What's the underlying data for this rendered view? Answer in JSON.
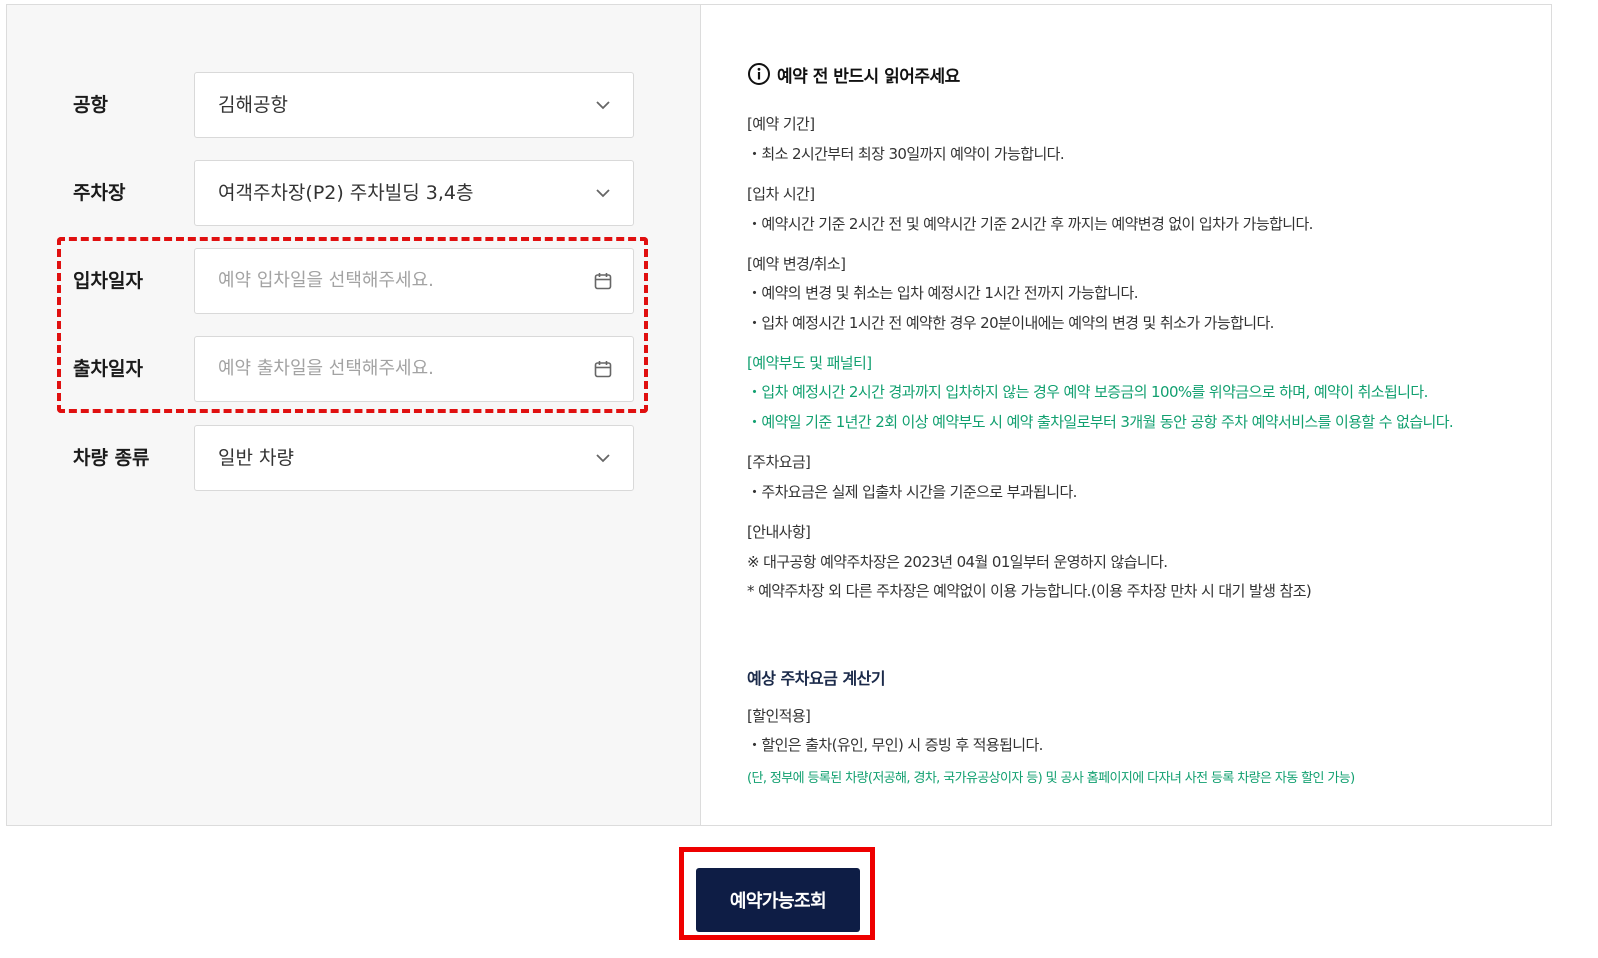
{
  "form": {
    "airport": {
      "label": "공항",
      "value": "김해공항"
    },
    "parking_lot": {
      "label": "주차장",
      "value": "여객주차장(P2) 주차빌딩 3,4층"
    },
    "entry_date": {
      "label": "입차일자",
      "placeholder": "예약 입차일을 선택해주세요."
    },
    "exit_date": {
      "label": "출차일자",
      "placeholder": "예약 출차일을 선택해주세요."
    },
    "vehicle_type": {
      "label": "차량 종류",
      "value": "일반 차량"
    }
  },
  "notice": {
    "title": "예약 전 반드시 읽어주세요",
    "reservation_period": {
      "heading": "[예약 기간]",
      "lines": [
        "・최소 2시간부터 최장 30일까지 예약이 가능합니다."
      ]
    },
    "entry_time": {
      "heading": "[입차 시간]",
      "lines": [
        "・예약시간 기준 2시간 전 및 예약시간 기준 2시간 후 까지는 예약변경 없이 입차가 가능합니다."
      ]
    },
    "change_cancel": {
      "heading": "[예약 변경/취소]",
      "lines": [
        "・예약의 변경 및 취소는 입차 예정시간 1시간 전까지 가능합니다.",
        "・입차 예정시간 1시간 전 예약한 경우 20분이내에는 예약의 변경 및 취소가 가능합니다."
      ]
    },
    "noshow_penalty": {
      "heading": "[예약부도 및 패널티]",
      "lines": [
        "・입차 예정시간 2시간 경과까지 입차하지 않는 경우 예약 보증금의 100%를 위약금으로 하며, 예약이 취소됩니다.",
        "・예약일 기준 1년간 2회 이상 예약부도 시 예약 출차일로부터 3개월 동안 공항 주차 예약서비스를 이용할 수 없습니다."
      ]
    },
    "parking_fee": {
      "heading": "[주차요금]",
      "lines": [
        "・주차요금은 실제 입출차 시간을 기준으로 부과됩니다."
      ]
    },
    "guide": {
      "heading": "[안내사항]",
      "lines": [
        "※ 대구공항 예약주차장은 2023년 04월 01일부터 운영하지 않습니다.",
        "* 예약주차장 외 다른 주차장은 예약없이 이용 가능합니다.(이용 주차장 만차 시 대기 발생 참조)"
      ]
    }
  },
  "calculator": {
    "title": "예상 주차요금 계산기",
    "discount_heading": "[할인적용]",
    "discount_line": "・할인은 출차(유인, 무인) 시 증빙 후 적용됩니다.",
    "discount_note": "(단, 정부에 등록된 차량(저공해, 경차, 국가유공상이자 등) 및 공사 홈페이지에 다자녀 사전 등록 차량은 자동 할인 가능)"
  },
  "search_button_label": "예약가능조회",
  "colors": {
    "accent_navy": "#0e1d45",
    "highlight_red": "#ee0000",
    "notice_green": "#12a070"
  },
  "icons": {
    "dropdown": "chevron-down-icon",
    "calendar": "calendar-icon",
    "info": "info-icon"
  }
}
